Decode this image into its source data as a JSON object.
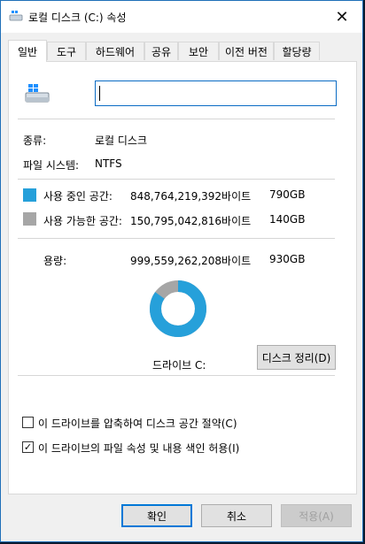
{
  "window": {
    "title": "로컬 디스크 (C:) 속성",
    "close_glyph": "✕"
  },
  "tabs": [
    {
      "label": "일반",
      "active": true
    },
    {
      "label": "도구",
      "active": false
    },
    {
      "label": "하드웨어",
      "active": false
    },
    {
      "label": "공유",
      "active": false
    },
    {
      "label": "보안",
      "active": false
    },
    {
      "label": "이전 버전",
      "active": false
    },
    {
      "label": "할당량",
      "active": false
    }
  ],
  "general": {
    "name_value": "",
    "type_label": "종류:",
    "type_value": "로컬 디스크",
    "fs_label": "파일 시스템:",
    "fs_value": "NTFS",
    "used": {
      "label": "사용 중인 공간:",
      "bytes": "848,764,219,392바이트",
      "size": "790GB",
      "color": "#26a0da"
    },
    "free": {
      "label": "사용 가능한 공간:",
      "bytes": "150,795,042,816바이트",
      "size": "140GB",
      "color": "#a6a6a6"
    },
    "capacity": {
      "label": "용량:",
      "bytes": "999,559,262,208바이트",
      "size": "930GB"
    },
    "drive_label": "드라이브 C:",
    "cleanup_button": "디스크 정리(D)",
    "compress_checkbox": {
      "label": "이 드라이브를 압축하여 디스크 공간 절약(C)",
      "checked": false
    },
    "index_checkbox": {
      "label": "이 드라이브의 파일 속성 및 내용 색인 허용(I)",
      "checked": true
    }
  },
  "usage_fraction": 0.849,
  "footer": {
    "ok": "확인",
    "cancel": "취소",
    "apply": "적용(A)"
  },
  "check_glyph": "✓"
}
